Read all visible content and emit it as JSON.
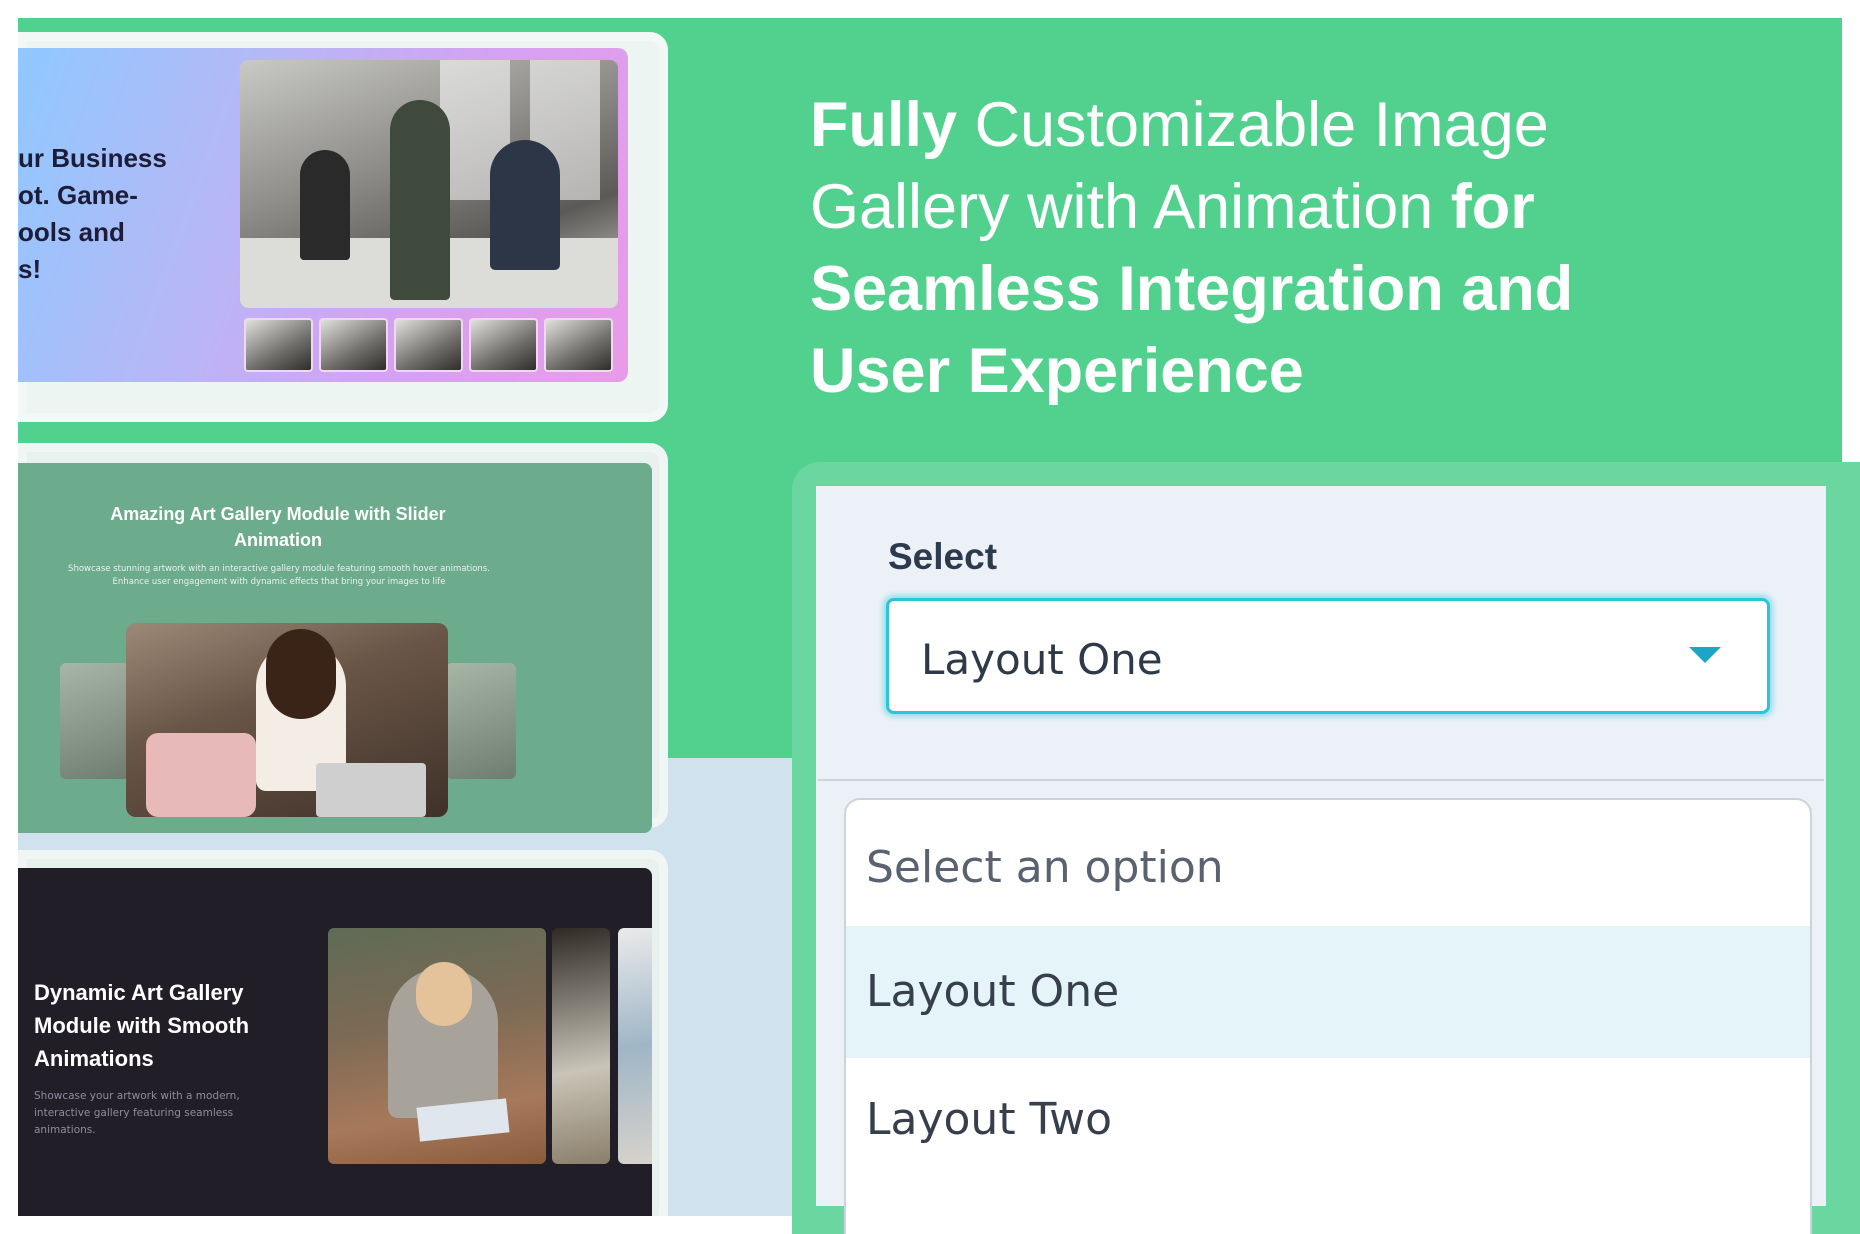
{
  "headline": {
    "part1_bold": "Fully",
    "part2": " Customizable Image Gallery with Animation ",
    "part3_bold": "for Seamless Integration and User Experience"
  },
  "cards": {
    "card1": {
      "headline": "ur Business\not. Game-\nools and\ns!"
    },
    "card2": {
      "title": "Amazing Art Gallery Module with Slider Animation",
      "subtitle": "Showcase stunning artwork with an interactive gallery module featuring smooth hover animations. Enhance user engagement with dynamic effects that bring your images to life"
    },
    "card3": {
      "title": "Dynamic Art Gallery Module with Smooth Animations",
      "subtitle": "Showcase your artwork with a modern, interactive gallery featuring seamless animations."
    }
  },
  "select": {
    "label": "Select",
    "value": "Layout One",
    "options": [
      "Select an option",
      "Layout One",
      "Layout Two"
    ],
    "highlighted_index": 1
  },
  "colors": {
    "green_bg": "#52d18e",
    "blue_bg": "#cfe2ee",
    "focus_ring": "#28c6d8",
    "caret": "#1aa6c4"
  }
}
